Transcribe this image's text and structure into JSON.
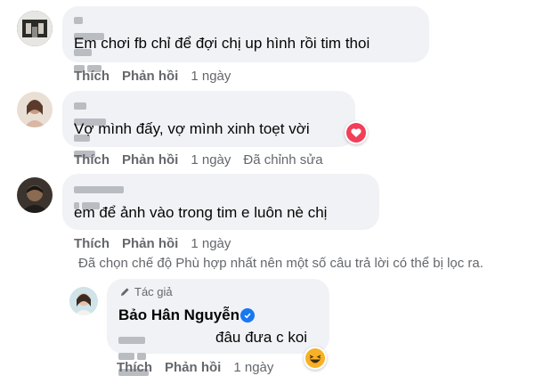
{
  "comments": [
    {
      "text": "Em chơi fb chỉ để đợi chị up hình rồi tim thoi",
      "actions": {
        "like": "Thích",
        "reply": "Phản hồi",
        "time": "1 ngày"
      }
    },
    {
      "text": "Vợ mình đấy, vợ mình xinh toẹt vời",
      "actions": {
        "like": "Thích",
        "reply": "Phản hồi",
        "time": "1 ngày",
        "edited": "Đã chỉnh sửa"
      },
      "reaction": "heart"
    },
    {
      "text": "em để ảnh vào trong tim e luôn nè chị",
      "actions": {
        "like": "Thích",
        "reply": "Phản hồi",
        "time": "1 ngày"
      }
    }
  ],
  "filter_notice": "Đã chọn chế độ Phù hợp nhất nên một số câu trả lời có thể bị lọc ra.",
  "reply": {
    "author_tag": "Tác giả",
    "author_name": "Bảo Hân Nguyễn",
    "text_visible": "đâu đưa c koi",
    "actions": {
      "like": "Thích",
      "reply": "Phản hồi",
      "time": "1 ngày"
    },
    "reaction": "laughing"
  },
  "colors": {
    "bubble": "#f0f2f5",
    "secondary_text": "#65676b",
    "verified": "#1877f2",
    "heart": "#f33e58"
  }
}
